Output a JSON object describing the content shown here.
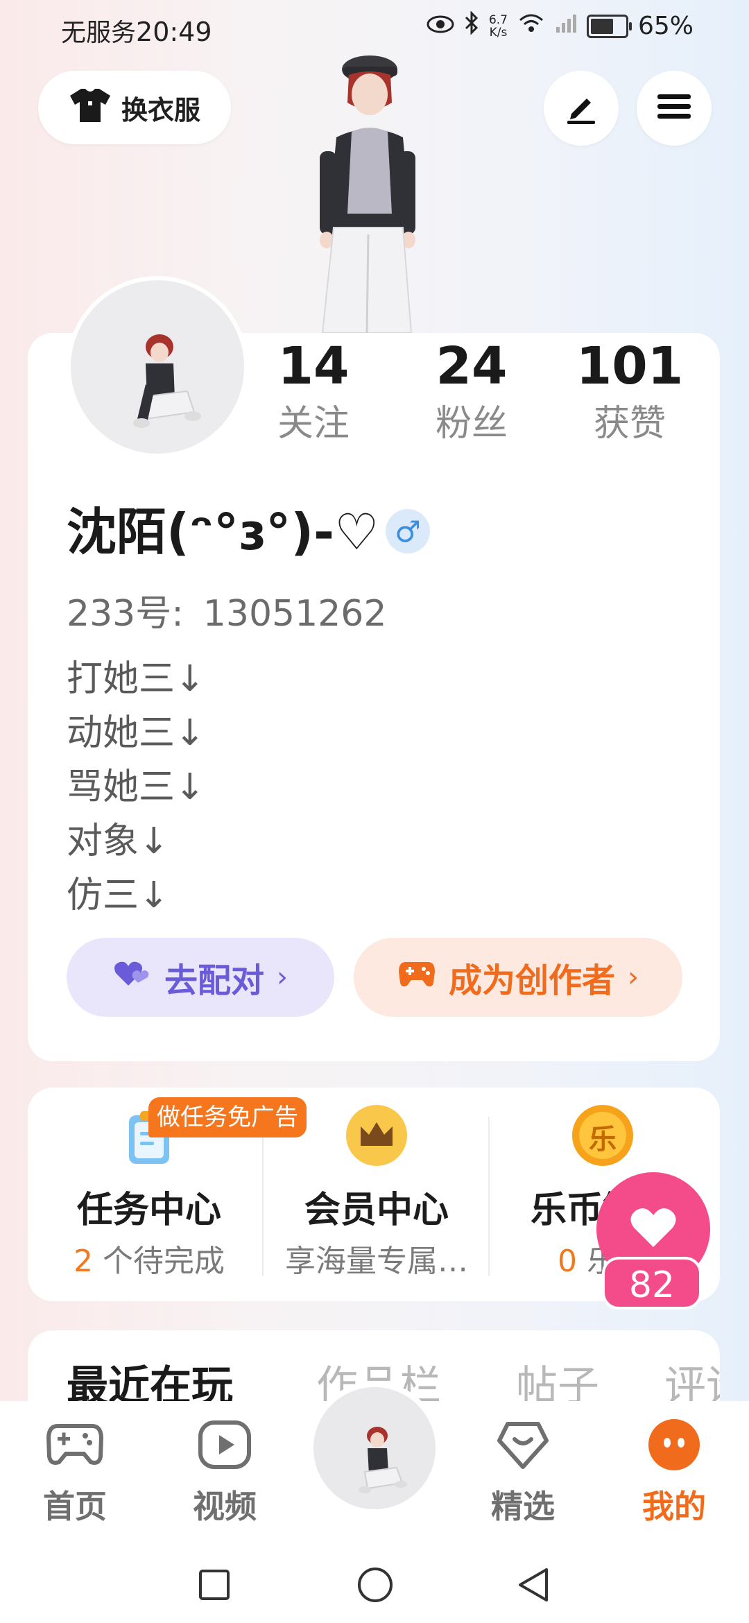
{
  "status_bar": {
    "carrier": "无服务",
    "time": "20:49",
    "net_speed_top": "6.7",
    "net_speed_bottom": "K/s",
    "battery": "65%"
  },
  "top_actions": {
    "dress_up_label": "换衣服",
    "edit_icon": "pen-icon",
    "menu_icon": "hamburger-icon"
  },
  "profile": {
    "stats": [
      {
        "value": "14",
        "label": "关注"
      },
      {
        "value": "24",
        "label": "粉丝"
      },
      {
        "value": "101",
        "label": "获赞"
      }
    ],
    "username": "沈陌(ᵔ°ɜ°)-♡",
    "gender_symbol": "♂",
    "id_label": "233号:",
    "id_value": "13051262",
    "bio_lines": [
      "打她三↓",
      "动她三↓",
      "骂她三↓",
      "对象↓",
      "仿三↓"
    ],
    "match_button": "去配对",
    "creator_button": "成为创作者",
    "chevron": "›"
  },
  "services": {
    "ad_badge": "做任务免广告",
    "items": [
      {
        "title": "任务中心",
        "count": "2",
        "sub": " 个待完成",
        "icon": "clipboard-icon"
      },
      {
        "title": "会员中心",
        "sub": "享海量专属…",
        "icon": "crown-icon"
      },
      {
        "title": "乐币钱包",
        "count": "0",
        "sub": " 乐币",
        "icon": "coin-icon",
        "coin_char": "乐"
      }
    ]
  },
  "float_like": {
    "count": "82"
  },
  "tabs": [
    "最近在玩",
    "作品栏",
    "帖子",
    "评论"
  ],
  "bottom_nav": [
    {
      "label": "首页",
      "icon": "gamepad-icon"
    },
    {
      "label": "视频",
      "icon": "play-icon"
    },
    {
      "label": "精选",
      "icon": "heart-box-icon"
    },
    {
      "label": "我的",
      "icon": "face-icon"
    }
  ],
  "colors": {
    "accent_orange": "#f06b1c",
    "match_purple": "#6a5bd8",
    "like_pink": "#f44b8b"
  }
}
